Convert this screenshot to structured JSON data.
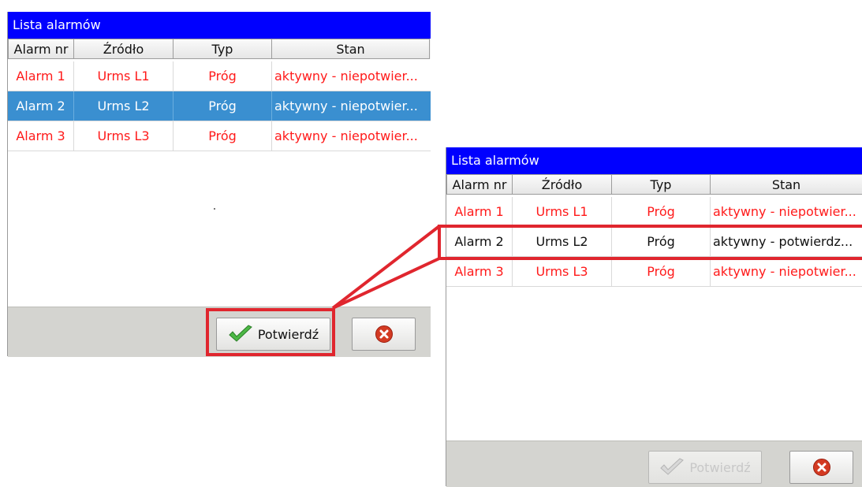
{
  "left_panel": {
    "title": "Lista alarmów",
    "columns": [
      "Alarm nr",
      "Źródło",
      "Typ",
      "Stan"
    ],
    "rows": [
      {
        "nr": "Alarm 1",
        "source": "Urms L1",
        "type": "Próg",
        "state": "aktywny - niepotwier..."
      },
      {
        "nr": "Alarm 2",
        "source": "Urms L2",
        "type": "Próg",
        "state": "aktywny - niepotwier..."
      },
      {
        "nr": "Alarm 3",
        "source": "Urms L3",
        "type": "Próg",
        "state": "aktywny - niepotwier..."
      }
    ],
    "confirm_label": "Potwierdź"
  },
  "right_panel": {
    "title": "Lista alarmów",
    "columns": [
      "Alarm nr",
      "Źródło",
      "Typ",
      "Stan"
    ],
    "rows": [
      {
        "nr": "Alarm 1",
        "source": "Urms L1",
        "type": "Próg",
        "state": "aktywny - niepotwier..."
      },
      {
        "nr": "Alarm 2",
        "source": "Urms L2",
        "type": "Próg",
        "state": "aktywny - potwierdz..."
      },
      {
        "nr": "Alarm 3",
        "source": "Urms L3",
        "type": "Próg",
        "state": "aktywny - niepotwier..."
      }
    ],
    "confirm_label": "Potwierdź"
  },
  "colors": {
    "title_bar": "#0000ff",
    "alarm_text": "#ff1a1a",
    "selected_row": "#3a8fd0",
    "highlight_frame": "#e0262e"
  },
  "icons": {
    "confirm": "checkmark-icon",
    "close": "close-x-icon"
  }
}
